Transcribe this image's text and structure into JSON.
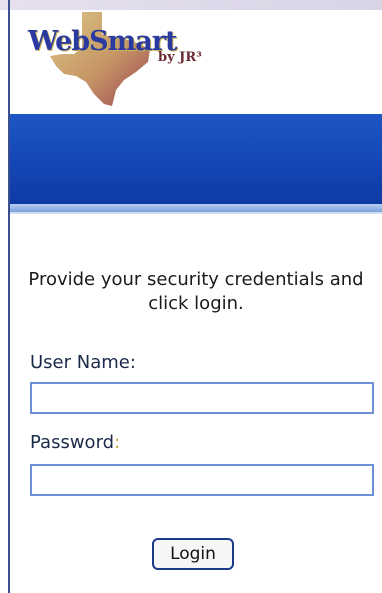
{
  "logo": {
    "name": "WebSmart",
    "byline": "by JR³",
    "colors": {
      "wordmark": "#2b3aa0",
      "texas": "#c9a85a",
      "byline": "#6a2a34"
    }
  },
  "header": {
    "band_color": "#1446b6"
  },
  "form": {
    "instructions": "Provide your security credentials and click login.",
    "username_label": "User Name:",
    "password_label": "Password",
    "password_colon": ":",
    "username_value": "",
    "password_value": "",
    "login_label": "Login"
  }
}
